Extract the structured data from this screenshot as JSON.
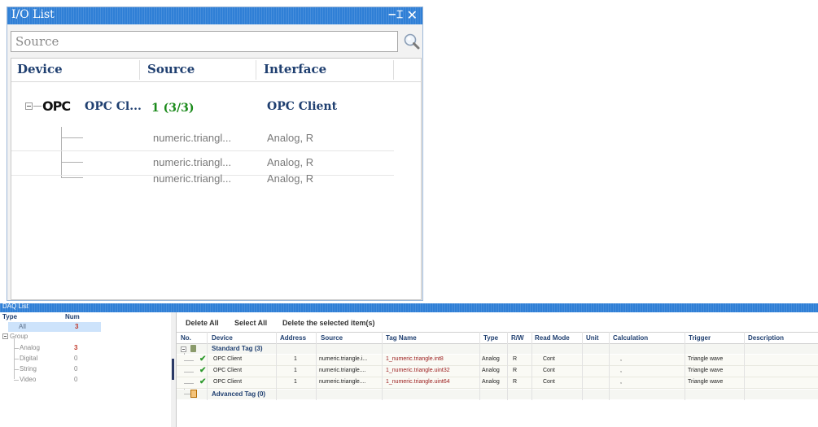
{
  "io_list": {
    "title": "I/O List",
    "search": {
      "placeholder": "Source"
    },
    "columns": [
      "Device",
      "Source",
      "Interface"
    ],
    "device": {
      "label": "OPC Cl...",
      "logo_text": "OPC",
      "source": "1 (3/3)",
      "interface": "OPC Client"
    },
    "rows": [
      {
        "source": "numeric.triangl...",
        "interface": "Analog, R"
      },
      {
        "source": "numeric.triangl...",
        "interface": "Analog, R"
      },
      {
        "source": "numeric.triangl...",
        "interface": "Analog, R"
      }
    ],
    "colors": {
      "titlebar": "#2f7fd6",
      "header_text": "#1f3f70",
      "count_green": "#1a8a1a"
    }
  },
  "daq_list": {
    "title": "DAQ List",
    "type_panel": {
      "headers": {
        "type": "Type",
        "num": "Num"
      },
      "all": {
        "label": "All",
        "num": "3"
      },
      "group": {
        "label": "Group"
      },
      "items": [
        {
          "label": "Analog",
          "num": "3"
        },
        {
          "label": "Digital",
          "num": "0"
        },
        {
          "label": "String",
          "num": "0"
        },
        {
          "label": "Video",
          "num": "0"
        }
      ]
    },
    "toolbar": {
      "delete_all": "Delete All",
      "select_all": "Select All",
      "delete_selected": "Delete the selected item(s)"
    },
    "columns": {
      "no": "No.",
      "device": "Device",
      "address": "Address",
      "source": "Source",
      "tag_name": "Tag Name",
      "type": "Type",
      "rw": "R/W",
      "read_mode": "Read Mode",
      "unit": "Unit",
      "calculation": "Calculation",
      "trigger": "Trigger",
      "description": "Description"
    },
    "standard_group": "Standard Tag (3)",
    "advanced_group": "Advanced Tag (0)",
    "rows": [
      {
        "device": "OPC Client",
        "address": "1",
        "source": "numeric.triangle.i...",
        "tag_name": "1_numeric.triangle.int8",
        "type": "Analog",
        "rw": "R",
        "read_mode": "Cont",
        "calculation": ",",
        "trigger": "Triangle wave"
      },
      {
        "device": "OPC Client",
        "address": "1",
        "source": "numeric.triangle....",
        "tag_name": "1_numeric.triangle.uint32",
        "type": "Analog",
        "rw": "R",
        "read_mode": "Cont",
        "calculation": ",",
        "trigger": "Triangle wave"
      },
      {
        "device": "OPC Client",
        "address": "1",
        "source": "numeric.triangle....",
        "tag_name": "1_numeric.triangle.uint64",
        "type": "Analog",
        "rw": "R",
        "read_mode": "Cont",
        "calculation": ",",
        "trigger": "Triangle wave"
      }
    ],
    "colors": {
      "selected": "#cde3fb",
      "num_red": "#c0392b",
      "check_green": "#2e9a2e"
    }
  }
}
